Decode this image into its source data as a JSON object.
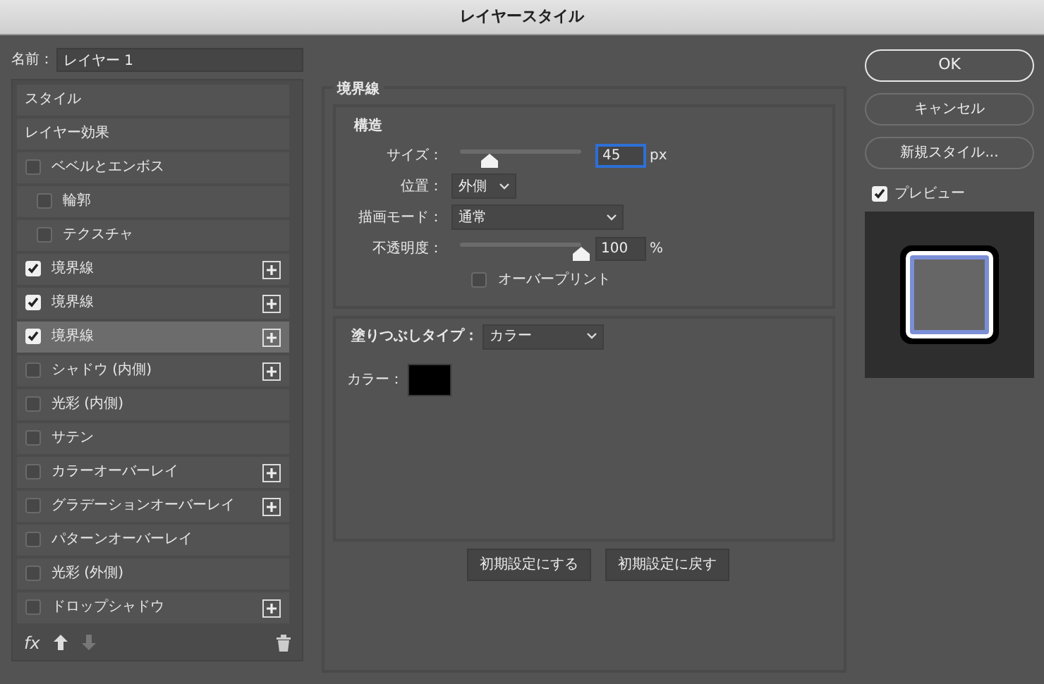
{
  "window": {
    "title": "レイヤースタイル"
  },
  "name_field": {
    "label": "名前：",
    "value": "レイヤー 1"
  },
  "style_list": [
    {
      "kind": "header",
      "label": "スタイル",
      "selected": false
    },
    {
      "kind": "header",
      "label": "レイヤー効果",
      "selected": false
    },
    {
      "kind": "effect",
      "label": "ベベルとエンボス",
      "checked": false,
      "addable": false,
      "selected": false,
      "children": [
        {
          "kind": "effect",
          "label": "輪郭",
          "checked": false,
          "addable": false,
          "selected": false
        },
        {
          "kind": "effect",
          "label": "テクスチャ",
          "checked": false,
          "addable": false,
          "selected": false
        }
      ]
    },
    {
      "kind": "effect",
      "label": "境界線",
      "checked": true,
      "addable": true,
      "selected": false
    },
    {
      "kind": "effect",
      "label": "境界線",
      "checked": true,
      "addable": true,
      "selected": false
    },
    {
      "kind": "effect",
      "label": "境界線",
      "checked": true,
      "addable": true,
      "selected": true
    },
    {
      "kind": "effect",
      "label": "シャドウ (内側)",
      "checked": false,
      "addable": true,
      "selected": false
    },
    {
      "kind": "effect",
      "label": "光彩 (内側)",
      "checked": false,
      "addable": false,
      "selected": false
    },
    {
      "kind": "effect",
      "label": "サテン",
      "checked": false,
      "addable": false,
      "selected": false
    },
    {
      "kind": "effect",
      "label": "カラーオーバーレイ",
      "checked": false,
      "addable": true,
      "selected": false
    },
    {
      "kind": "effect",
      "label": "グラデーションオーバーレイ",
      "checked": false,
      "addable": true,
      "selected": false
    },
    {
      "kind": "effect",
      "label": "パターンオーバーレイ",
      "checked": false,
      "addable": false,
      "selected": false
    },
    {
      "kind": "effect",
      "label": "光彩 (外側)",
      "checked": false,
      "addable": false,
      "selected": false
    },
    {
      "kind": "effect",
      "label": "ドロップシャドウ",
      "checked": false,
      "addable": true,
      "selected": false
    }
  ],
  "list_footer": {
    "fx_label": "fx",
    "move_down_disabled": true
  },
  "panel": {
    "title": "境界線",
    "structure": {
      "title": "構造",
      "rows": [
        {
          "kind": "slider",
          "label": "サイズ：",
          "level": 0.24,
          "value": "45",
          "unit": "px",
          "focused": true
        },
        {
          "kind": "select",
          "label": "位置：",
          "value": "外側",
          "wide": false
        },
        {
          "kind": "select",
          "label": "描画モード：",
          "value": "通常",
          "wide": true
        },
        {
          "kind": "slider",
          "label": "不透明度：",
          "level": 1,
          "value": "100",
          "unit": "%",
          "focused": false
        },
        {
          "kind": "checkbox",
          "label": "オーバープリント",
          "checked": false
        }
      ]
    },
    "fill": {
      "label": "塗りつぶしタイプ：",
      "value": "カラー",
      "color_label": "カラー：",
      "color": "#000000"
    },
    "buttons": [
      "初期設定にする",
      "初期設定に戻す"
    ]
  },
  "actions": [
    {
      "label": "OK",
      "default": true
    },
    {
      "label": "キャンセル",
      "default": false
    },
    {
      "label": "新規スタイル...",
      "default": false
    }
  ],
  "preview": {
    "label": "プレビュー",
    "checked": true
  }
}
